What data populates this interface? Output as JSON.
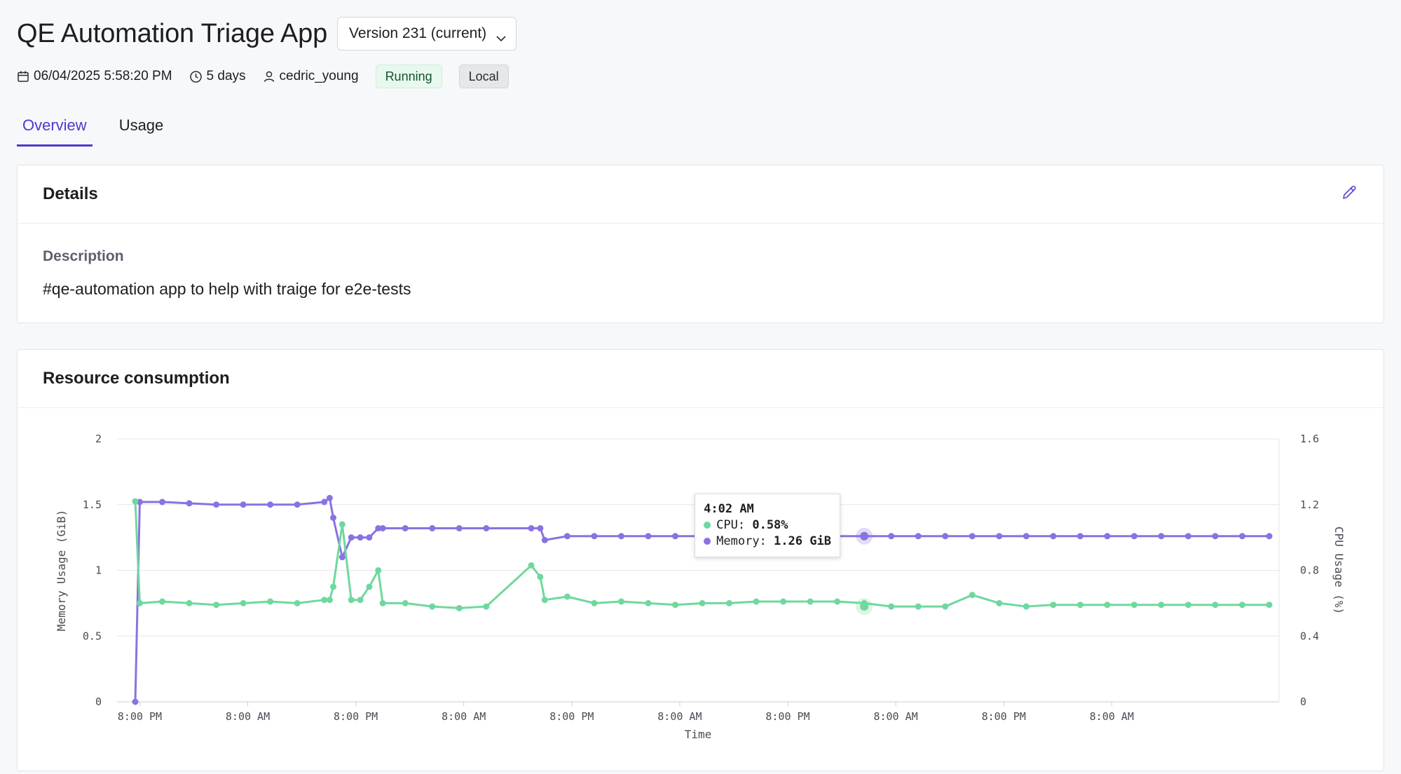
{
  "app": {
    "title": "QE Automation Triage App",
    "version_label": "Version 231 (current)"
  },
  "meta": {
    "created": "06/04/2025 5:58:20 PM",
    "age": "5 days",
    "owner": "cedric_young",
    "status": "Running",
    "location": "Local",
    "icons": [
      "calendar-icon",
      "clock-icon",
      "user-icon"
    ]
  },
  "tabs": [
    {
      "label": "Overview",
      "active": true
    },
    {
      "label": "Usage",
      "active": false
    }
  ],
  "details": {
    "title": "Details",
    "description_label": "Description",
    "description": "#qe-automation app to help with traige for e2e-tests"
  },
  "resource": {
    "title": "Resource consumption"
  },
  "tooltip": {
    "time": "4:02 AM",
    "cpu_label": "CPU:",
    "cpu_value": "0.58%",
    "memory_label": "Memory:",
    "memory_value": "1.26 GiB"
  },
  "colors": {
    "accent": "#4a3ad1",
    "cpu": "#6fd89e",
    "memory": "#8a72e0"
  },
  "chart_data": {
    "type": "line",
    "xlabel": "Time",
    "ylabel_left": "Memory Usage (GiB)",
    "ylabel_right": "CPU Usage (%)",
    "ylim_left": [
      0,
      2
    ],
    "ylim_right": [
      0,
      1.6
    ],
    "yticks_left": [
      "0",
      "0.5",
      "1",
      "1.5",
      "2"
    ],
    "yticks_right": [
      "0",
      "0.4",
      "0.8",
      "1.2",
      "1.6"
    ],
    "xticks": [
      "8:00 PM",
      "8:00 AM",
      "8:00 PM",
      "8:00 AM",
      "8:00 PM",
      "8:00 AM",
      "8:00 PM",
      "8:00 AM",
      "8:00 PM",
      "8:00 AM"
    ],
    "grid": true,
    "x_hours": [
      0,
      0.5,
      3,
      6,
      9,
      12,
      15,
      18,
      21,
      21.6,
      22,
      23,
      24,
      25,
      26,
      27,
      27.5,
      30,
      33,
      36,
      39,
      44,
      45,
      45.5,
      48,
      51,
      54,
      57,
      60,
      63,
      66,
      69,
      72,
      75,
      78,
      81,
      84,
      87,
      90,
      93,
      96,
      99,
      102,
      105,
      108,
      111,
      114,
      117,
      120,
      123,
      126
    ],
    "series": [
      {
        "name": "Memory",
        "axis": "left",
        "color": "#8a72e0",
        "values": [
          0,
          1.52,
          1.52,
          1.51,
          1.5,
          1.5,
          1.5,
          1.5,
          1.52,
          1.55,
          1.4,
          1.1,
          1.25,
          1.25,
          1.25,
          1.32,
          1.32,
          1.32,
          1.32,
          1.32,
          1.32,
          1.32,
          1.32,
          1.23,
          1.26,
          1.26,
          1.26,
          1.26,
          1.26,
          1.26,
          1.26,
          1.26,
          1.26,
          1.26,
          1.26,
          1.26,
          1.26,
          1.26,
          1.26,
          1.26,
          1.26,
          1.26,
          1.26,
          1.26,
          1.26,
          1.26,
          1.26,
          1.26,
          1.26,
          1.26,
          1.26
        ]
      },
      {
        "name": "CPU",
        "axis": "right",
        "color": "#6fd89e",
        "values": [
          1.22,
          0.6,
          0.61,
          0.6,
          0.59,
          0.6,
          0.61,
          0.6,
          0.62,
          0.62,
          0.7,
          1.08,
          0.62,
          0.62,
          0.7,
          0.8,
          0.6,
          0.6,
          0.58,
          0.57,
          0.58,
          0.83,
          0.76,
          0.62,
          0.64,
          0.6,
          0.61,
          0.6,
          0.59,
          0.6,
          0.6,
          0.61,
          0.61,
          0.61,
          0.61,
          0.6,
          0.58,
          0.58,
          0.58,
          0.65,
          0.6,
          0.58,
          0.59,
          0.59,
          0.59,
          0.59,
          0.59,
          0.59,
          0.59,
          0.59,
          0.59
        ]
      }
    ]
  }
}
